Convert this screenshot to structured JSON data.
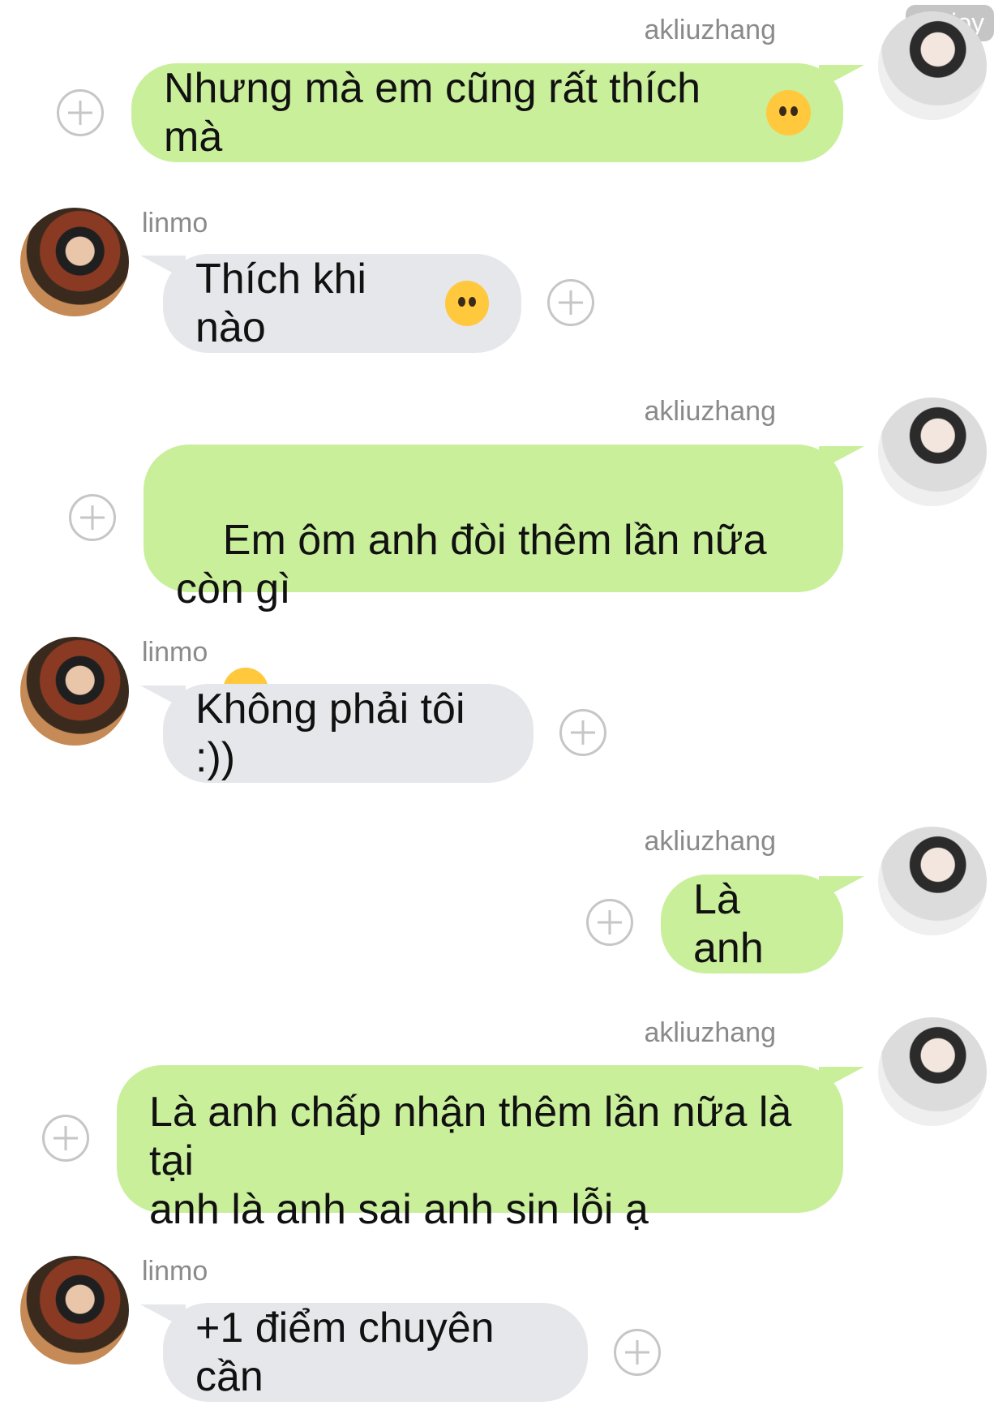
{
  "watermark": "70 joy",
  "messages": [
    {
      "sender": "akliuzhang",
      "text": "Nhưng mà em cũng rất thích mà",
      "emoji": "pleading-face-emoji"
    },
    {
      "sender": "linmo",
      "text": "Thích khi nào",
      "emoji": "slightly-smiling-face-emoji"
    },
    {
      "sender": "akliuzhang",
      "text": "Em ôm anh đòi thêm lần nữa còn gì",
      "emoji": "kissing-face-emoji"
    },
    {
      "sender": "linmo",
      "text": "Không phải tôi :))"
    },
    {
      "sender": "akliuzhang",
      "text": "Là anh"
    },
    {
      "sender": "akliuzhang",
      "text": "Là anh chấp nhận thêm lần nữa là tại\nanh là anh sai anh sin lỗi ạ"
    },
    {
      "sender": "linmo",
      "text": "+1 điểm chuyên cần"
    }
  ],
  "colors": {
    "outgoing_bubble": "#c9ef9b",
    "incoming_bubble": "#e6e7ea",
    "name_text": "#8a8a8a"
  }
}
